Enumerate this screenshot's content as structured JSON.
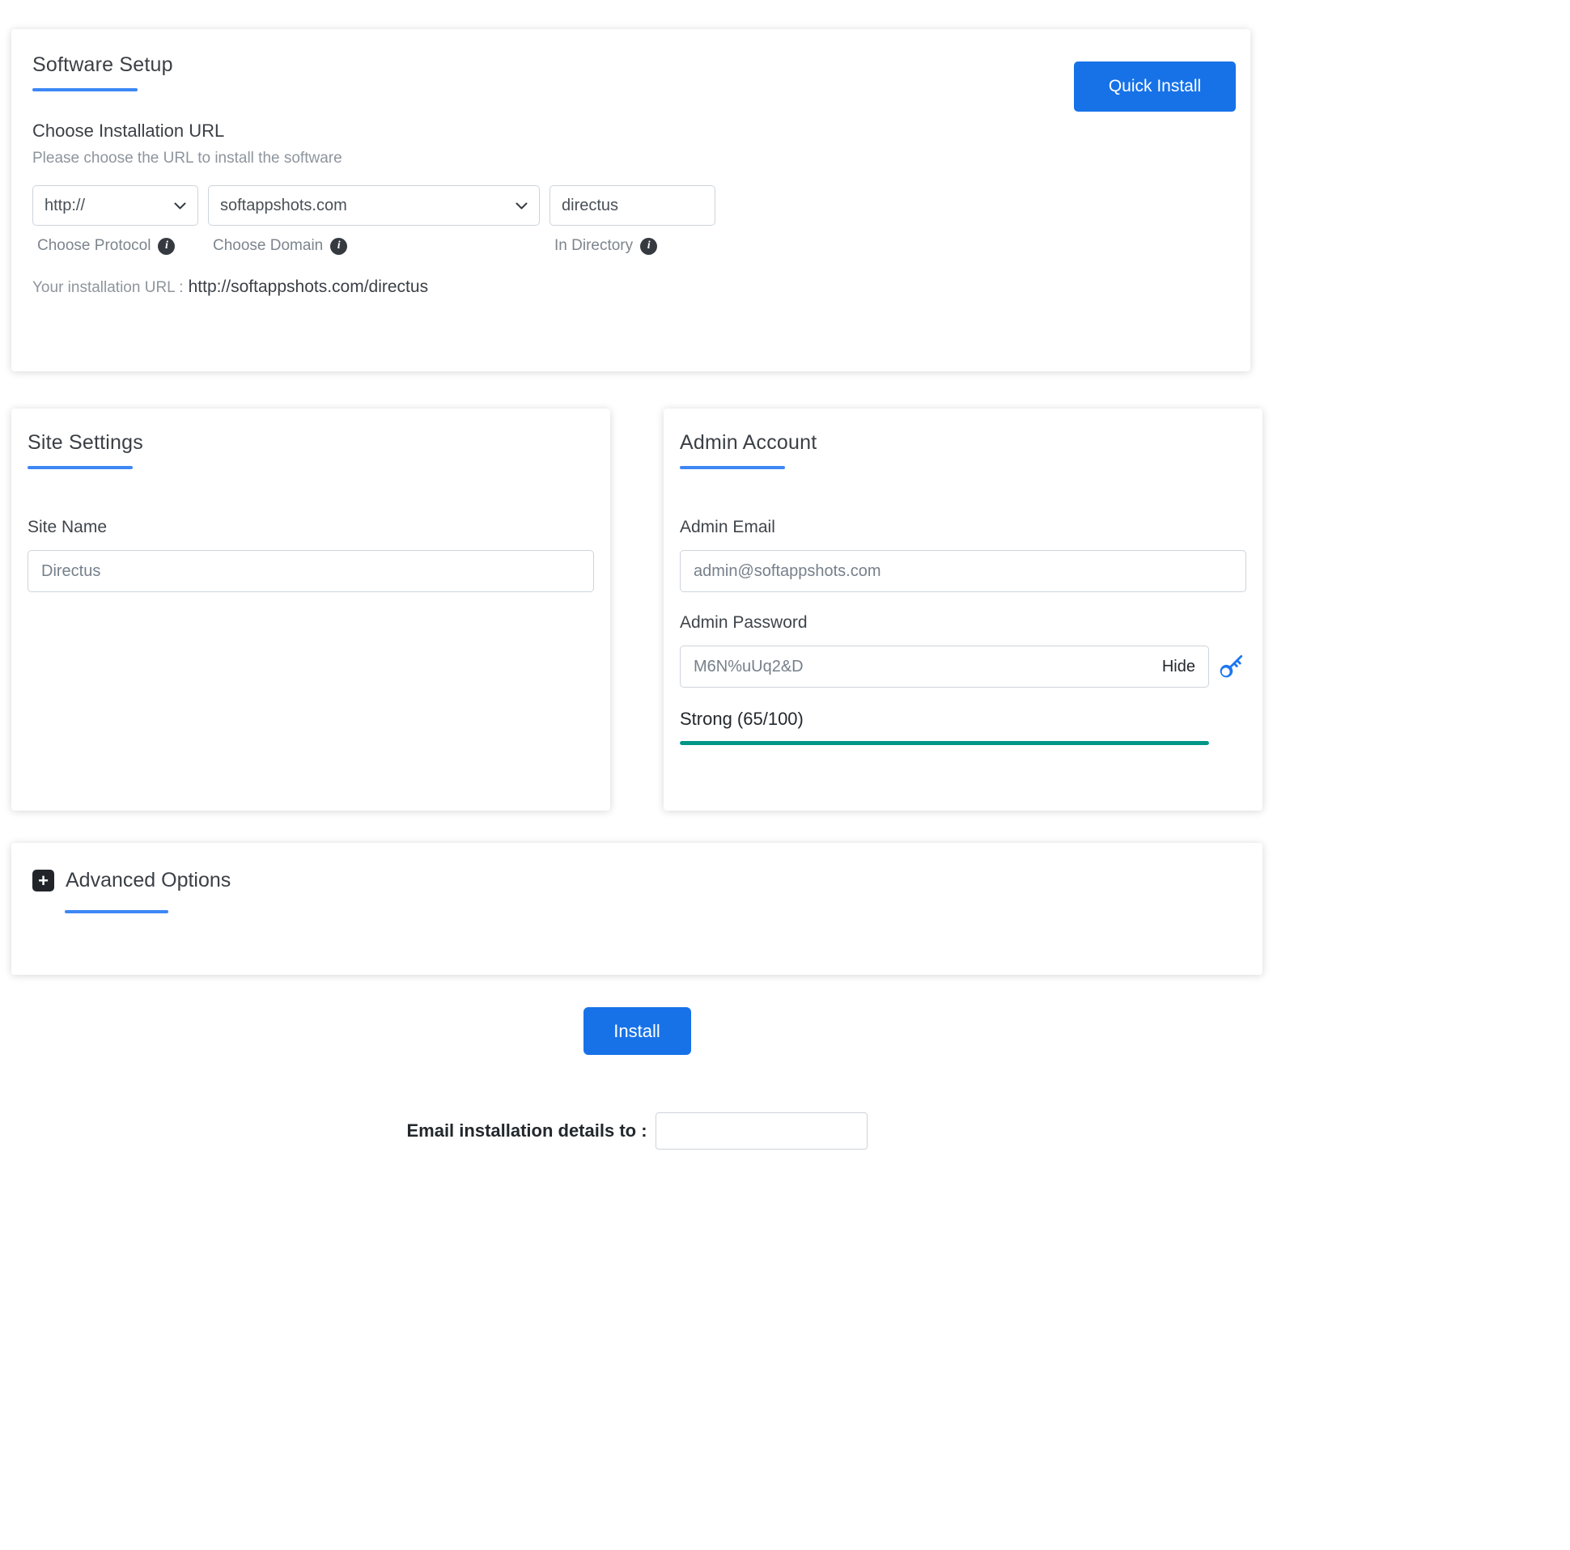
{
  "icons": {
    "info_glyph": "i",
    "plus_glyph": "+"
  },
  "colors": {
    "accent": "#1772e8",
    "underline": "#3d87f5",
    "strength": "#009688"
  },
  "software_setup": {
    "title": "Software Setup",
    "quick_install_label": "Quick Install",
    "choose_url_heading": "Choose Installation URL",
    "choose_url_subtext": "Please choose the URL to install the software",
    "protocol": {
      "value": "http://",
      "label": "Choose Protocol"
    },
    "domain": {
      "value": "softappshots.com",
      "label": "Choose Domain"
    },
    "directory": {
      "value": "directus",
      "label": "In Directory"
    },
    "installation_url_label": "Your installation URL :",
    "installation_url_value": "http://softappshots.com/directus"
  },
  "site_settings": {
    "title": "Site Settings",
    "site_name_label": "Site Name",
    "site_name_value": "Directus"
  },
  "admin_account": {
    "title": "Admin Account",
    "email_label": "Admin Email",
    "email_value": "admin@softappshots.com",
    "password_label": "Admin Password",
    "password_value": "M6N%uUq2&D",
    "hide_label": "Hide",
    "strength_text": "Strong (65/100)",
    "strength_percent": 100
  },
  "advanced_options": {
    "title": "Advanced Options"
  },
  "install_button_label": "Install",
  "email_details": {
    "label": "Email installation details to :",
    "value": ""
  }
}
